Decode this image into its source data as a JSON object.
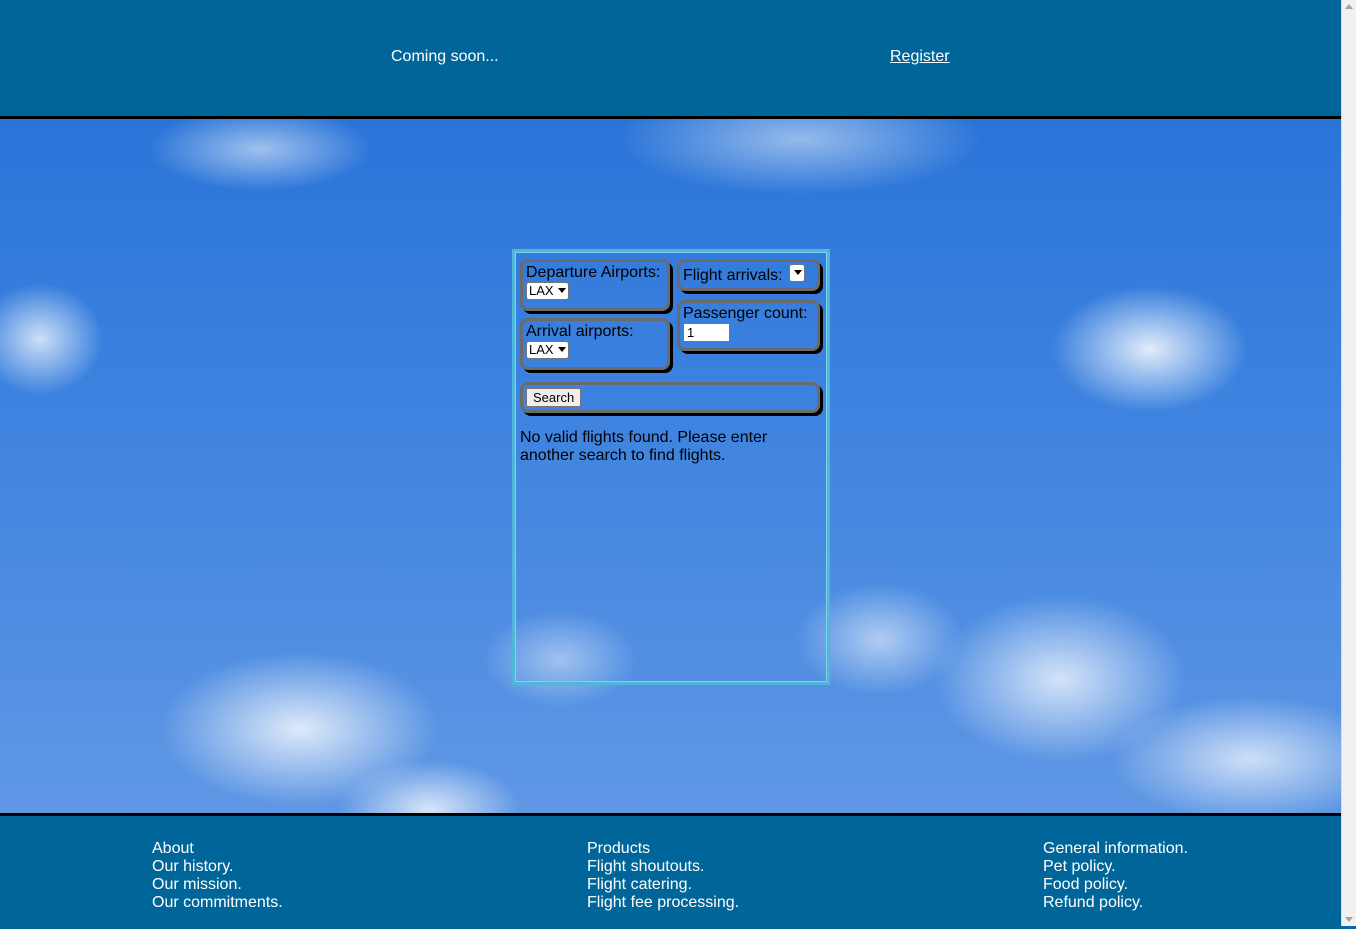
{
  "header": {
    "coming_soon": "Coming soon...",
    "register_link": "Register"
  },
  "search_form": {
    "departure": {
      "label": "Departure Airports:",
      "selected": "LAX"
    },
    "arrival": {
      "label": "Arrival airports:",
      "selected": "LAX"
    },
    "flight_arrivals": {
      "label": "Flight arrivals:",
      "selected": ""
    },
    "passenger_count": {
      "label": "Passenger count:",
      "value": "1"
    },
    "search_button": "Search",
    "message": "No valid flights found. Please enter another search to find flights."
  },
  "footer": {
    "col1": [
      "About",
      "Our history.",
      "Our mission.",
      "Our commitments."
    ],
    "col2": [
      "Products",
      "Flight shoutouts.",
      "Flight catering.",
      "Flight fee processing."
    ],
    "col3": [
      "General information.",
      "Pet policy.",
      "Food policy.",
      "Refund policy."
    ]
  },
  "colors": {
    "header_bg": "#006699",
    "footer_bg": "#006699",
    "panel_border": "#4fb8d8",
    "sky": "#3f84e0"
  }
}
